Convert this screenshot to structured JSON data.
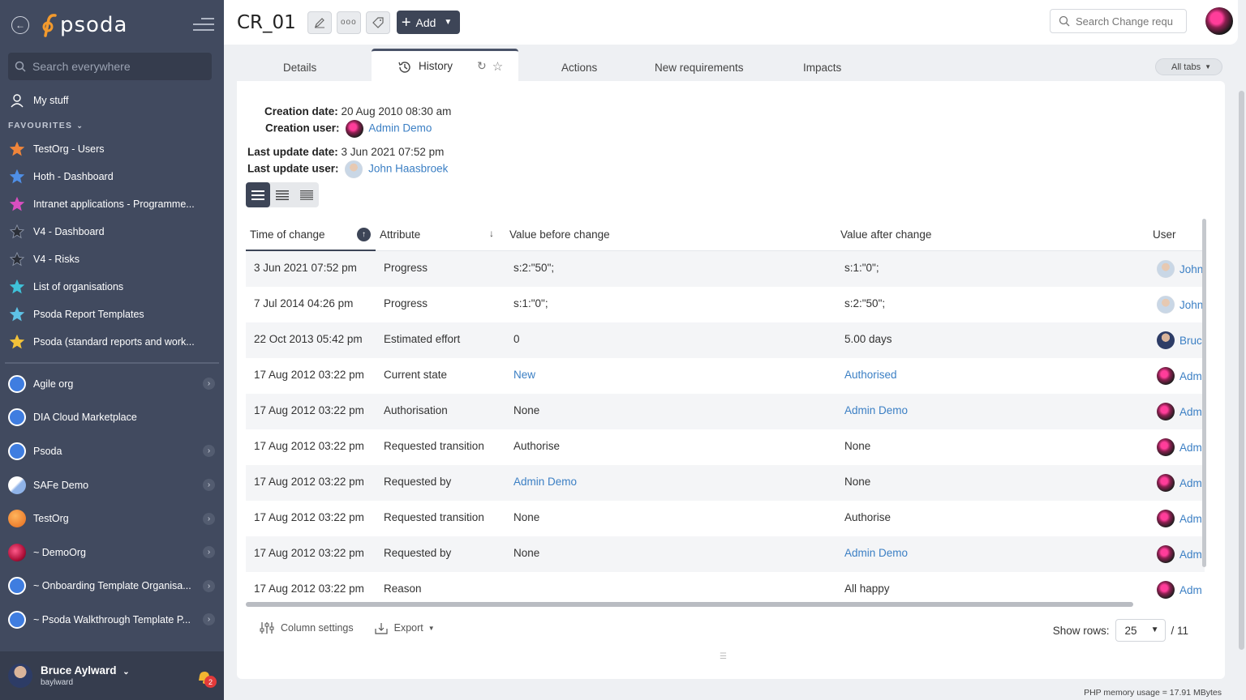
{
  "sidebar": {
    "logo_text": "psoda",
    "search_placeholder": "Search everywhere",
    "my_stuff": "My stuff",
    "favourites_label": "FAVOURITES",
    "favourites": [
      {
        "label": "TestOrg - Users",
        "color": "#f0853a"
      },
      {
        "label": "Hoth - Dashboard",
        "color": "#4f8fe6"
      },
      {
        "label": "Intranet applications - Programme...",
        "color": "#d94fc0"
      },
      {
        "label": "V4 - Dashboard",
        "color": "#2b2f38"
      },
      {
        "label": "V4 - Risks",
        "color": "#2b2f38"
      },
      {
        "label": "List of organisations",
        "color": "#3fc1d8"
      },
      {
        "label": "Psoda Report Templates",
        "color": "#5ec2e6"
      },
      {
        "label": "Psoda (standard reports and work...",
        "color": "#f2c23a"
      }
    ],
    "orgs": [
      {
        "label": "Agile org",
        "arrow": true
      },
      {
        "label": "DIA Cloud Marketplace",
        "arrow": false
      },
      {
        "label": "Psoda",
        "arrow": true
      },
      {
        "label": "SAFe Demo",
        "arrow": true
      },
      {
        "label": "TestOrg",
        "arrow": true
      },
      {
        "label": "~ DemoOrg",
        "arrow": true
      },
      {
        "label": "~ Onboarding Template Organisa...",
        "arrow": true
      },
      {
        "label": "~ Psoda Walkthrough Template P...",
        "arrow": true
      }
    ],
    "user_name": "Bruce Aylward",
    "user_login": "baylward",
    "notification_count": "2"
  },
  "header": {
    "title": "CR_01",
    "add_label": "Add",
    "search_placeholder": "Search Change requ"
  },
  "tabs": {
    "details": "Details",
    "history": "History",
    "actions": "Actions",
    "new_requirements": "New requirements",
    "impacts": "Impacts",
    "all_tabs": "All tabs"
  },
  "meta": {
    "creation_date_label": "Creation date:",
    "creation_date": "20 Aug 2010 08:30 am",
    "creation_user_label": "Creation user:",
    "creation_user": "Admin Demo",
    "last_update_date_label": "Last update date:",
    "last_update_date": "3 Jun 2021 07:52 pm",
    "last_update_user_label": "Last update user:",
    "last_update_user": "John Haasbroek"
  },
  "table": {
    "columns": [
      "Time of change",
      "Attribute",
      "Value before change",
      "Value after change",
      "User"
    ],
    "rows": [
      {
        "time": "3 Jun 2021 07:52 pm",
        "attr": "Progress",
        "before": "s:2:\"50\";",
        "before_link": false,
        "after": "s:1:\"0\";",
        "after_link": false,
        "user": "John",
        "av": "john"
      },
      {
        "time": "7 Jul 2014 04:26 pm",
        "attr": "Progress",
        "before": "s:1:\"0\";",
        "before_link": false,
        "after": "s:2:\"50\";",
        "after_link": false,
        "user": "John",
        "av": "john"
      },
      {
        "time": "22 Oct 2013 05:42 pm",
        "attr": "Estimated effort",
        "before": "0",
        "before_link": false,
        "after": "5.00 days",
        "after_link": false,
        "user": "Bruc",
        "av": "bruce"
      },
      {
        "time": "17 Aug 2012 03:22 pm",
        "attr": "Current state",
        "before": "New",
        "before_link": true,
        "after": "Authorised",
        "after_link": true,
        "user": "Adm",
        "av": "admin"
      },
      {
        "time": "17 Aug 2012 03:22 pm",
        "attr": "Authorisation",
        "before": "None",
        "before_link": false,
        "after": "Admin Demo",
        "after_link": true,
        "user": "Adm",
        "av": "admin"
      },
      {
        "time": "17 Aug 2012 03:22 pm",
        "attr": "Requested transition",
        "before": "Authorise",
        "before_link": false,
        "after": "None",
        "after_link": false,
        "user": "Adm",
        "av": "admin"
      },
      {
        "time": "17 Aug 2012 03:22 pm",
        "attr": "Requested by",
        "before": "Admin Demo",
        "before_link": true,
        "after": "None",
        "after_link": false,
        "user": "Adm",
        "av": "admin"
      },
      {
        "time": "17 Aug 2012 03:22 pm",
        "attr": "Requested transition",
        "before": "None",
        "before_link": false,
        "after": "Authorise",
        "after_link": false,
        "user": "Adm",
        "av": "admin"
      },
      {
        "time": "17 Aug 2012 03:22 pm",
        "attr": "Requested by",
        "before": "None",
        "before_link": false,
        "after": "Admin Demo",
        "after_link": true,
        "user": "Adm",
        "av": "admin"
      },
      {
        "time": "17 Aug 2012 03:22 pm",
        "attr": "Reason",
        "before": "",
        "before_link": false,
        "after": "All happy",
        "after_link": false,
        "user": "Adm",
        "av": "admin"
      }
    ]
  },
  "footer": {
    "column_settings": "Column settings",
    "export": "Export",
    "show_rows_label": "Show rows:",
    "show_rows_value": "25",
    "total_pages": "/ 11",
    "memory_note": "PHP memory usage = 17.91 MBytes"
  },
  "colors": {
    "sidebar_bg": "#414a5f",
    "accent_dark": "#3d4557",
    "link": "#3b7fc4"
  }
}
